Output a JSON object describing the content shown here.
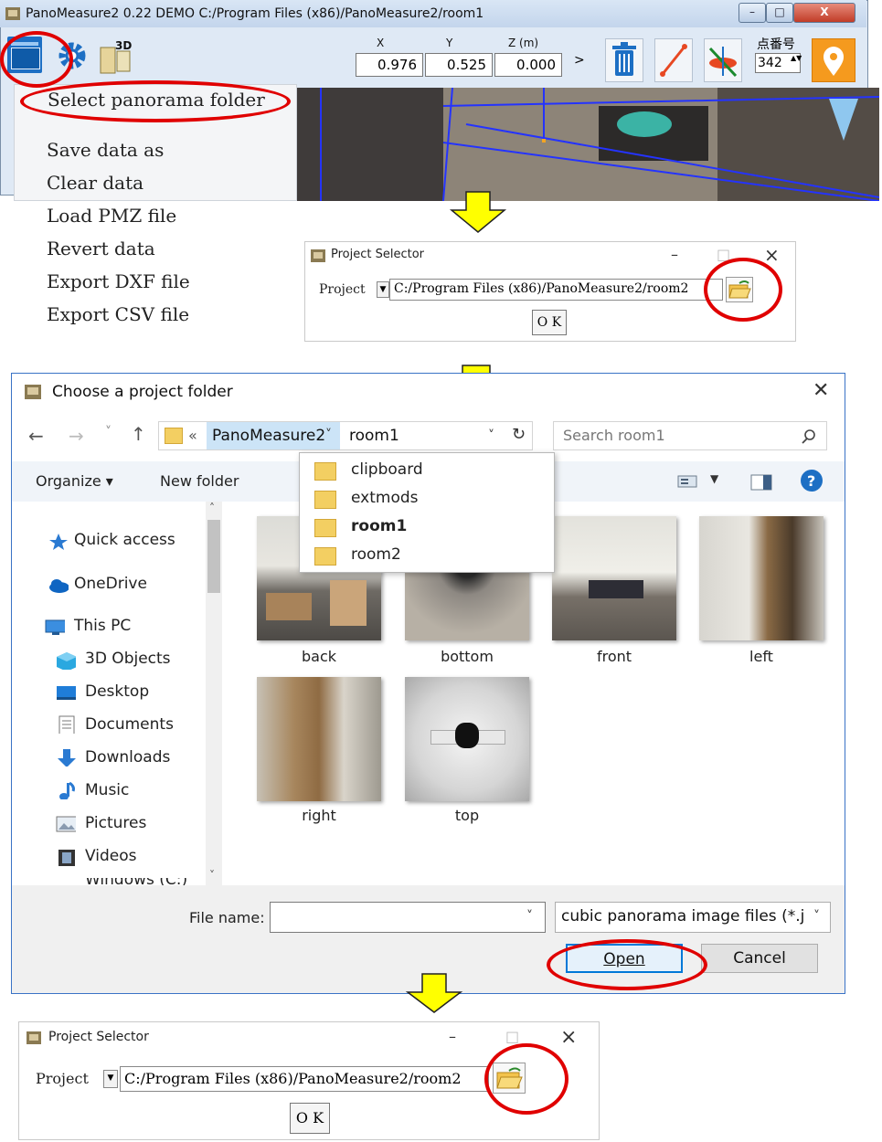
{
  "app_window": {
    "title": "PanoMeasure2 0.22 DEMO  C:/Program Files (x86)/PanoMeasure2/room1",
    "window_buttons": {
      "minimize": "–",
      "maximize": "□",
      "close": "X"
    },
    "coords": {
      "x_label": "X",
      "y_label": "Y",
      "z_label": "Z (m)",
      "x_value": "0.976",
      "y_value": "0.525",
      "z_value": "0.000",
      "more": ">"
    },
    "point_number": {
      "label": "点番号",
      "value": "342",
      "spinner": "▲▼"
    },
    "menu": {
      "items": [
        "Select panorama folder",
        "Save data as",
        "Clear data",
        "Load PMZ file",
        "Revert data",
        "Export DXF file",
        "Export CSV file"
      ]
    }
  },
  "project_selector_1": {
    "title": "Project Selector",
    "controls": {
      "minimize": "–",
      "maximize": "□",
      "close": "×"
    },
    "project_label": "Project",
    "dropdown_arrow": "▼",
    "path": "C:/Program Files (x86)/PanoMeasure2/room2",
    "ok": "O K"
  },
  "dialog": {
    "title": "Choose a project folder",
    "close": "✕",
    "nav": {
      "back": "←",
      "forward": "→",
      "recent": "˅",
      "up": "↑"
    },
    "address": {
      "chevron": "«",
      "crumb": "PanoMeasure2",
      "crumb_arrow": "˅",
      "current": "room1",
      "dropdown": "˅",
      "refresh": "↻"
    },
    "search_placeholder": "Search room1",
    "commands": {
      "organize": "Organize ▾",
      "new_folder": "New folder"
    },
    "folder_dropdown": [
      "clipboard",
      "extmods",
      "room1",
      "room2"
    ],
    "sidebar": {
      "quick_access": "Quick access",
      "onedrive": "OneDrive",
      "this_pc": "This PC",
      "items": [
        "3D Objects",
        "Desktop",
        "Documents",
        "Downloads",
        "Music",
        "Pictures",
        "Videos"
      ],
      "partial": "Windows (C:)"
    },
    "files": [
      "back",
      "bottom",
      "front",
      "left",
      "right",
      "top"
    ],
    "file_name_label": "File name:",
    "file_name_value": "",
    "file_type": "cubic panorama image files (*.j",
    "open": "Open",
    "cancel": "Cancel"
  },
  "project_selector_2": {
    "title": "Project Selector",
    "controls": {
      "minimize": "–",
      "maximize": "□",
      "close": "×"
    },
    "project_label": "Project",
    "dropdown_arrow": "▼",
    "path": "C:/Program Files (x86)/PanoMeasure2/room2",
    "ok": "O K"
  },
  "colors": {
    "highlight_ring": "#e00000",
    "arrow": "#ffff00",
    "accent_blue": "#1d6fc4"
  }
}
